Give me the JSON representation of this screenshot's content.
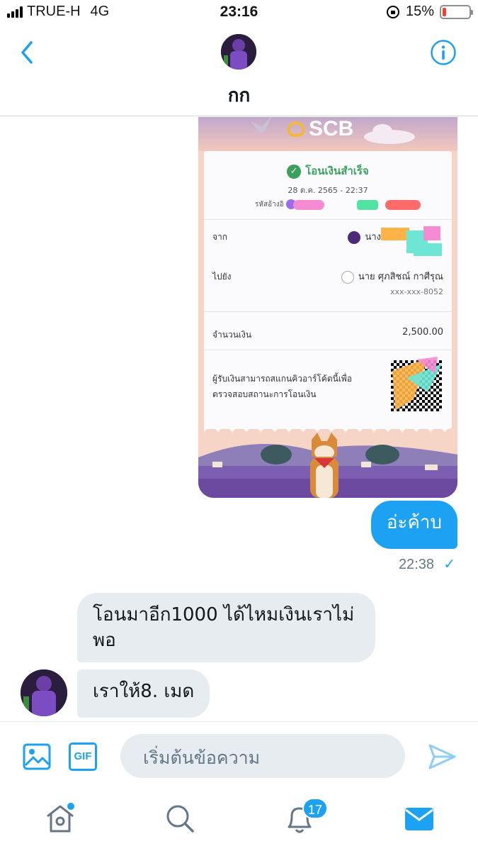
{
  "status_bar": {
    "carrier": "TRUE-H",
    "network": "4G",
    "time": "23:16",
    "battery": "15%",
    "battery_level": 0.15
  },
  "header": {
    "contact_name": "กก"
  },
  "receipt": {
    "bank_logo": "SCB",
    "status": "โอนเงินสำเร็จ",
    "datetime": "28 ต.ค. 2565 - 22:37",
    "reference_label": "รหัสอ้างอิ",
    "from_label": "จาก",
    "from_name": "นาง",
    "to_label": "ไปยัง",
    "to_name": "นาย ศุภสิชณ์ กาศีรุณ",
    "to_account": "xxx-xxx-8052",
    "amount_label": "จำนวนเงิน",
    "amount": "2,500.00",
    "scan_text": "ผู้รับเงินสามารถสแกนคิวอาร์โค้ดนี้เพื่อตรวจสอบสถานะการโอนเงิน"
  },
  "messages": {
    "outgoing_text": "อ่ะค้าบ",
    "outgoing_time": "22:38",
    "read_mark": "✓",
    "incoming_1": "โอนมาอีก1000 ได้ไหมเงินเราไม่พอ",
    "incoming_2": "เราให้8. เมด"
  },
  "composer": {
    "placeholder": "เริ่มต้นข้อความ",
    "gif_label": "GIF"
  },
  "tabbar": {
    "notification_count": "17"
  },
  "colors": {
    "accent": "#1da1f2",
    "incoming_bubble": "#e6ecf0",
    "success_green": "#3aa05d"
  }
}
